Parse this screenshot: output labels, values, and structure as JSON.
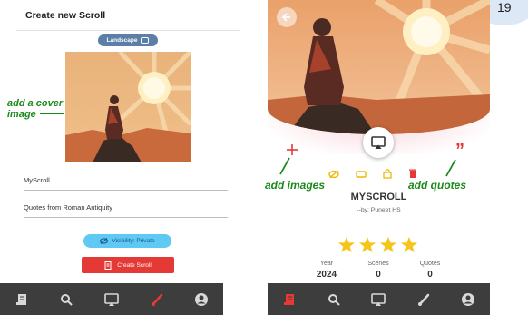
{
  "left": {
    "title": "Create new Scroll",
    "landscape_label": "Landscape",
    "annotation_cover": "add a cover image",
    "title_field_value": "MyScroll",
    "description_field_value": "Quotes from Roman Antiquity",
    "visibility_label": "Visibility: Private",
    "create_label": "Create Scroll"
  },
  "right": {
    "scroll_title": "MYSCROLL",
    "byline": "--by: Puneet HS",
    "annotation_images": "add images",
    "annotation_quotes": "add quotes",
    "rating_stars": 4,
    "stats": [
      {
        "label": "Year",
        "value": "2024"
      },
      {
        "label": "Scenes",
        "value": "0"
      },
      {
        "label": "Quotes",
        "value": "0"
      }
    ]
  },
  "bottom_nav": {
    "icons": [
      "scroll-icon",
      "search-icon",
      "airplay-icon",
      "brush-icon",
      "account-icon"
    ],
    "left_active": "brush-icon",
    "right_active": "scroll-icon",
    "active_color": "#e53935",
    "inactive_color": "#d8d8d8"
  },
  "page_number": "19",
  "colors": {
    "annotation_green": "#1b8a1b",
    "accent_red": "#e53935",
    "star_yellow": "#f5c518",
    "action_yellow": "#f2b705"
  }
}
